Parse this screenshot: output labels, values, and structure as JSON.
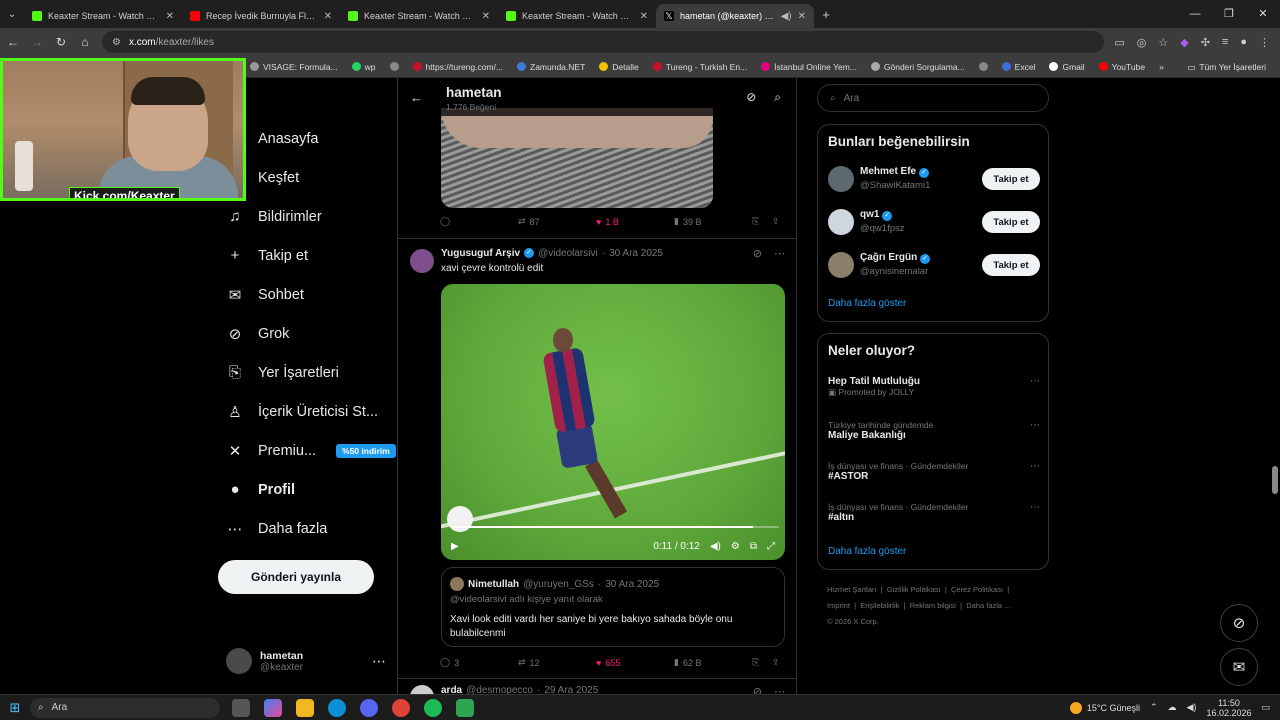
{
  "browser": {
    "tabs": [
      {
        "title": "Keaxter Stream - Watch Live on",
        "color": "#53fc18",
        "active": false
      },
      {
        "title": "Recep İvedik Burnuyla Flüt Çalı",
        "color": "#ff0000",
        "active": false
      },
      {
        "title": "Keaxter Stream - Watch Live on",
        "color": "#53fc18",
        "active": false
      },
      {
        "title": "Keaxter Stream - Watch Live on",
        "color": "#53fc18",
        "active": false
      },
      {
        "title": "hametan (@keaxter) adlı ku",
        "color": "#ffffff",
        "active": true
      }
    ],
    "url_host": "x.com",
    "url_path": "/keaxter/likes",
    "bookmarks": [
      {
        "label": "VISAGE: Formula...",
        "color": "#999999"
      },
      {
        "label": "wp",
        "color": "#25d366"
      },
      {
        "label": "",
        "color": "#888888"
      },
      {
        "label": "https://tureng.com/...",
        "color": "#c8102e"
      },
      {
        "label": "Zamunda.NET",
        "color": "#3d7bd9"
      },
      {
        "label": "Detalle",
        "color": "#f3c300"
      },
      {
        "label": "Tureng - Turkish En...",
        "color": "#c8102e"
      },
      {
        "label": "İstanbul Online Yem...",
        "color": "#e5007e"
      },
      {
        "label": "Gönderi Sorgulama...",
        "color": "#aaaaaa"
      },
      {
        "label": "",
        "color": "#888888"
      },
      {
        "label": "Excel",
        "color": "#3b6ed8"
      },
      {
        "label": "Gmail",
        "color": "#ffffff"
      },
      {
        "label": "YouTube",
        "color": "#ff0000"
      }
    ],
    "all_bookmarks": "Tüm Yer İşaretleri"
  },
  "webcam": {
    "label": "Kick.com/Keaxter"
  },
  "nav": {
    "items": [
      {
        "label": "Anasayfa",
        "icon": "⌂"
      },
      {
        "label": "Keşfet",
        "icon": "⌕"
      },
      {
        "label": "Bildirimler",
        "icon": "♫"
      },
      {
        "label": "Takip et",
        "icon": "+"
      },
      {
        "label": "Sohbet",
        "icon": "✉"
      },
      {
        "label": "Grok",
        "icon": "⊘"
      },
      {
        "label": "Yer İşaretleri",
        "icon": "⎘"
      },
      {
        "label": "İçerik Üreticisi St...",
        "icon": "♙"
      },
      {
        "label": "Premiu...",
        "icon": "✕"
      },
      {
        "label": "Profil",
        "icon": "●"
      },
      {
        "label": "Daha fazla",
        "icon": "⋯"
      }
    ],
    "premium_badge": "%50 indirim",
    "post_button": "Gönderi yayınla",
    "account_name": "hametan",
    "account_handle": "@keaxter"
  },
  "header": {
    "title": "hametan",
    "subtitle": "1.776 Beğeni"
  },
  "prev_tweet_actions": {
    "replies": "",
    "reposts": "87",
    "likes": "1 B",
    "views": "39 B"
  },
  "tweet": {
    "name": "Yugusuguf Arşiv",
    "handle": "@videolarsivi",
    "date": "30 Ara 2025",
    "text": "xavi çevre kontrolü edit",
    "video_time": "0:11 / 0:12",
    "video_progress": 0.92,
    "quote": {
      "name": "Nimetullah",
      "handle": "@yuruyen_GSs",
      "date": "30 Ara 2025",
      "reply_to": "@videolarsivi adlı kişiye yanıt olarak",
      "text": "Xavi look editi vardı her saniye bi yere bakıyo sahada böyle onu bulabilcenmi"
    },
    "actions": {
      "replies": "3",
      "reposts": "12",
      "likes": "655",
      "views": "62 B"
    }
  },
  "next_tweet": {
    "name": "arda",
    "handle": "@desmopecco",
    "date": "29 Ara 2025"
  },
  "search": {
    "placeholder": "Ara"
  },
  "suggestions": {
    "title": "Bunları beğenebilirsin",
    "people": [
      {
        "name": "Mehmet Efe",
        "handle": "@ShawiKatami1",
        "button": "Takip et"
      },
      {
        "name": "qw1",
        "handle": "@qw1fpsz",
        "button": "Takip et"
      },
      {
        "name": "Çağrı Ergün",
        "handle": "@aynisinemalar",
        "button": "Takip et"
      }
    ],
    "show_more": "Daha fazla göster"
  },
  "trends": {
    "title": "Neler oluyor?",
    "items": [
      {
        "category": "",
        "title": "Hep Tatil Mutluluğu",
        "promo": "Promoted by JOLLY"
      },
      {
        "category": "Türkiye tarihinde gündemde",
        "title": "Maliye Bakanlığı",
        "promo": ""
      },
      {
        "category": "İş dünyası ve finans · Gündemdekiler",
        "title": "#ASTOR",
        "promo": ""
      },
      {
        "category": "İş dünyası ve finans · Gündemdekiler",
        "title": "#altın",
        "promo": ""
      }
    ],
    "show_more": "Daha fazla göster"
  },
  "footer": {
    "links": [
      "Hizmet Şartları",
      "Gizlilik Politikası",
      "Çerez Politikası",
      "Imprint",
      "Erişilebilirlik",
      "Reklam bilgisi",
      "Daha fazla ..."
    ],
    "copyright": "© 2026 X Corp."
  },
  "taskbar": {
    "search": "Ara",
    "weather": "15°C  Güneşli",
    "time": "11:50",
    "date": "16.02.2026"
  }
}
